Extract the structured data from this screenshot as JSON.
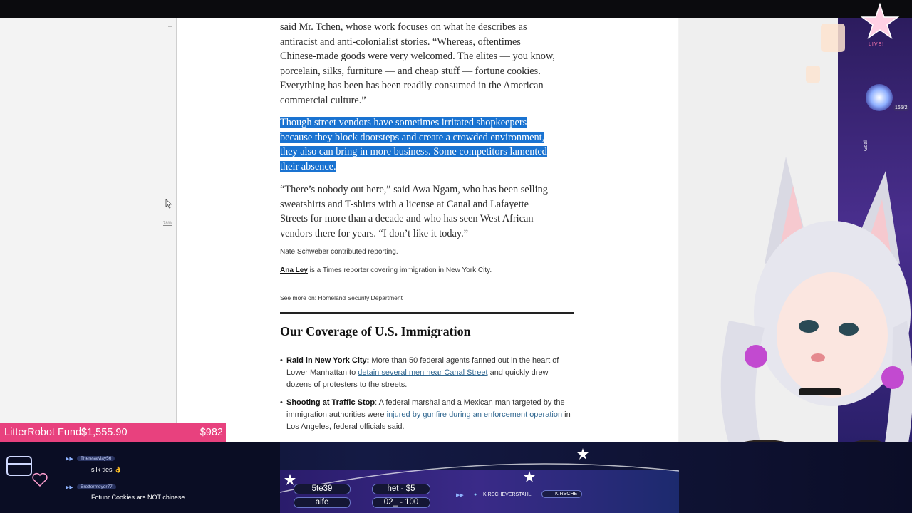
{
  "article": {
    "para1_lines": [
      "said Mr. Tchen, whose work focuses on what he describes as",
      "antiracist and anti-colonialist stories. “Whereas, oftentimes",
      "Chinese-made goods were very welcomed. The elites — you know,",
      "porcelain, silks, furniture — and cheap stuff — fortune cookies.",
      "Everything has been has been readily consumed in the American",
      "commercial culture.”"
    ],
    "para2_lines": [
      "Though street vendors have sometimes irritated shopkeepers",
      "because they block doorsteps and create a crowded environment,",
      "they also can bring in more business. Some competitors lamented",
      "their absence."
    ],
    "para3_lines": [
      "“There’s nobody out here,” said Awa Ngam, who has been selling",
      "sweatshirts and T-shirts with a license at Canal and Lafayette",
      "Streets for more than a decade and who has seen West African",
      "vendors there for years. “I don’t like it today.”"
    ],
    "contrib": "Nate Schweber contributed reporting.",
    "author_name": "Ana Ley",
    "author_desc": " is a Times reporter covering immigration in New York City.",
    "see_more_label": "See more on: ",
    "see_more_link": "Homeland Security Department",
    "coverage_heading": "Our Coverage of U.S. Immigration",
    "bullets": [
      {
        "bold": "Raid in New York City:",
        "pre": " More than 50 federal agents fanned out in the heart of Lower Manhattan to ",
        "link": "detain several men near Canal Street",
        "post": " and quickly drew dozens of protesters to the streets."
      },
      {
        "bold": "Shooting at Traffic Stop",
        "pre": ": A federal marshal and a Mexican man targeted by the immigration authorities were ",
        "link": "injured by gunfire during an enforcement operation",
        "post": " in Los Angeles, federal officials said."
      }
    ],
    "zoom_label": "78%"
  },
  "overlay": {
    "fund_name": "LitterRobot Fund",
    "fund_amount": "$1,555.90",
    "fund_goal": "$982",
    "chat": [
      {
        "user": "TheresaMay56",
        "message": "silk ties 👌"
      },
      {
        "user": "Brettermeyer77",
        "message": "Fotunr Cookies are NOT chinese"
      }
    ],
    "pills": [
      "5te39",
      "het - $5",
      "alfe",
      "02_ - 100"
    ],
    "socials": [
      "KIRSCHEVERSTAHL",
      "KIRSCHE"
    ],
    "live_label": "LIVE!",
    "counter": "165/2",
    "goal_label": "Goal"
  },
  "colors": {
    "highlight": "#1a73d1",
    "fund_bar": "#e8417e",
    "link": "#326891"
  }
}
